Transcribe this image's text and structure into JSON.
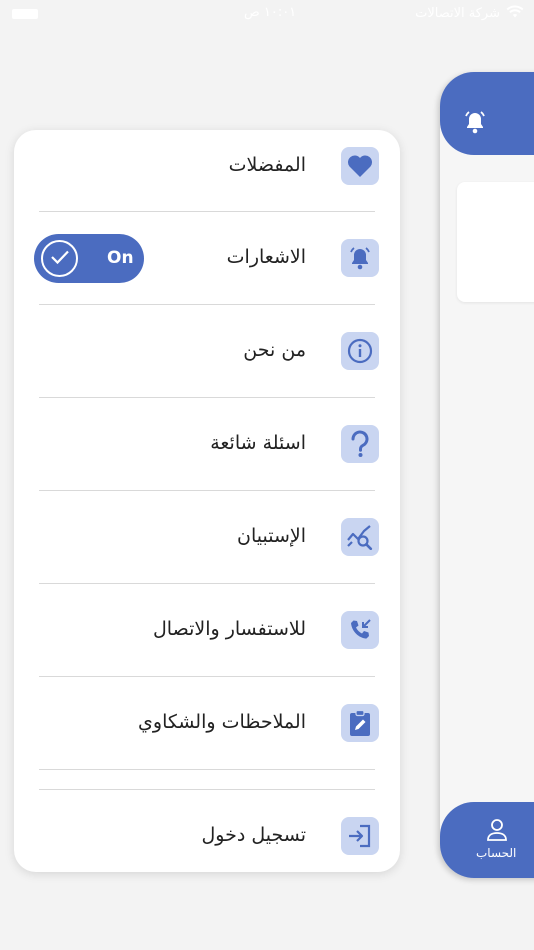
{
  "status_bar": {
    "time": "١٠:٠١ ص",
    "carrier": "شركة الاتصالات"
  },
  "colors": {
    "accent": "#4b6cc0",
    "icon_bg": "#c9d5f1",
    "background": "#f3f3f3"
  },
  "menu": {
    "items": [
      {
        "label": "المفضلات",
        "icon": "heart-icon"
      },
      {
        "label": "الاشعارات",
        "icon": "bell-icon"
      },
      {
        "label": "من نحن",
        "icon": "info-icon"
      },
      {
        "label": "اسئلة شائعة",
        "icon": "question-icon"
      },
      {
        "label": "الإستبيان",
        "icon": "survey-chart-icon"
      },
      {
        "label": "للاستفسار والاتصال",
        "icon": "phone-incoming-icon"
      },
      {
        "label": "الملاحظات والشكاوي",
        "icon": "clipboard-edit-icon"
      },
      {
        "label": "تسجيل دخول",
        "icon": "login-icon"
      }
    ],
    "notifications_toggle": {
      "state_label": "On",
      "enabled": true
    }
  },
  "bottom_tab": {
    "label": "الحساب",
    "icon": "user-icon"
  }
}
